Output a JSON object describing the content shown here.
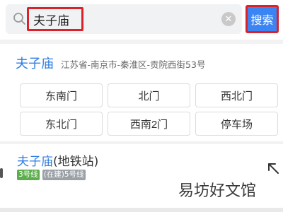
{
  "search": {
    "query": "夫子庙",
    "search_button": "搜索",
    "clear_icon": "clear-icon",
    "search_icon": "search-icon"
  },
  "results": [
    {
      "name": "夫子庙",
      "address": "江苏省-南京市-秦淮区-贡院西街53号",
      "entrances": [
        "东南门",
        "北门",
        "西北门",
        "东北门",
        "西南2门",
        "停车场"
      ]
    },
    {
      "name_highlight": "夫子庙",
      "name_suffix": "(地铁站)",
      "tags": [
        "3号线",
        "(在建)5号线"
      ],
      "route_icon": "arrow-up-left-icon"
    }
  ],
  "watermark": "易坊好文馆",
  "colors": {
    "accent_blue": "#2f7de1",
    "button_blue": "#3b84f4",
    "highlight_red": "#d8232a",
    "line3_green": "#5cae4c"
  }
}
